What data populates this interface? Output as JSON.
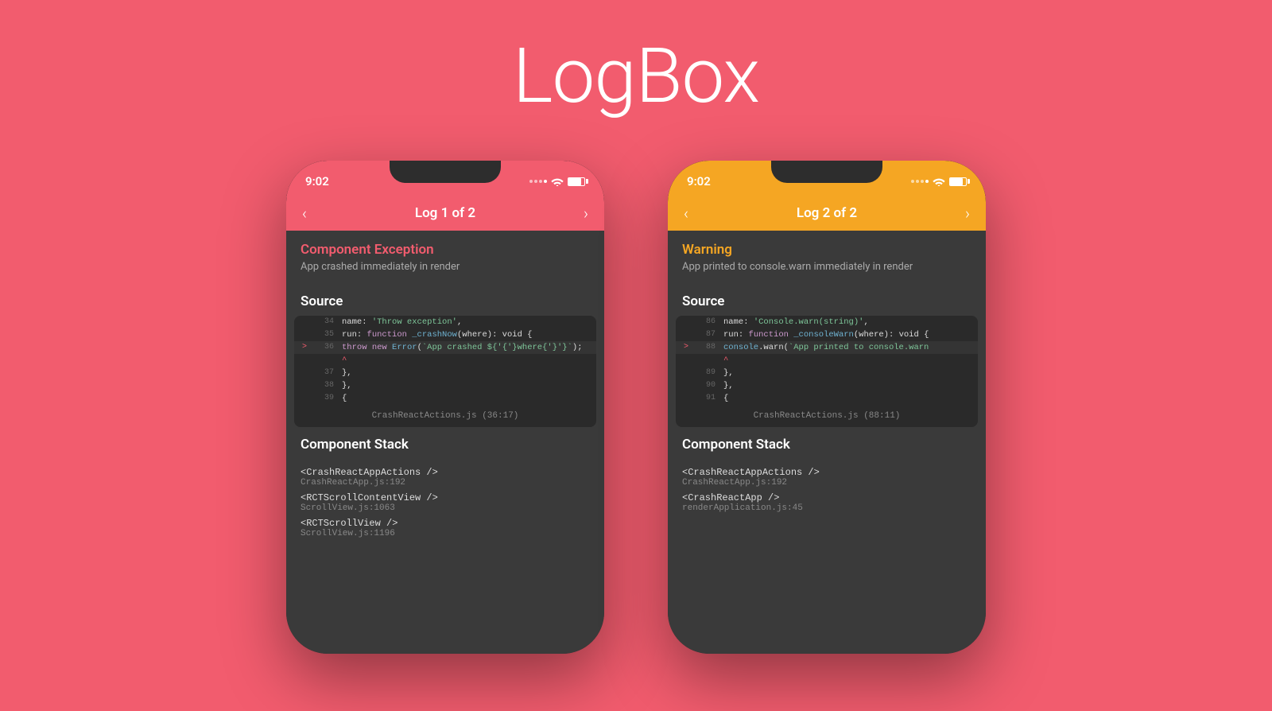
{
  "page": {
    "title": "LogBox",
    "background": "#f25c6e"
  },
  "phone1": {
    "status_time": "9:02",
    "header_title": "Log 1 of 2",
    "header_prev": "‹",
    "header_next": "›",
    "error_title": "Component Exception",
    "error_title_color": "red",
    "error_subtitle": "App crashed immediately in render",
    "source_label": "Source",
    "code_lines": [
      {
        "num": "34",
        "marker": "",
        "text": "name: 'Throw exception',"
      },
      {
        "num": "35",
        "marker": "",
        "text": "run: function _crashNow(where): void {"
      },
      {
        "num": "36",
        "marker": ">",
        "text": "    throw new Error(`App crashed ${where}`);"
      },
      {
        "num": "",
        "marker": "",
        "text": "           ^"
      },
      {
        "num": "37",
        "marker": "",
        "text": "   },"
      },
      {
        "num": "38",
        "marker": "",
        "text": "},"
      },
      {
        "num": "39",
        "marker": "",
        "text": "{"
      }
    ],
    "code_footer": "CrashReactActions.js (36:17)",
    "stack_label": "Component Stack",
    "stack_items": [
      {
        "component": "<CrashReactAppActions />",
        "file": "CrashReactApp.js:192"
      },
      {
        "component": "<RCTScrollContentView />",
        "file": "ScrollView.js:1063"
      },
      {
        "component": "<RCTScrollView />",
        "file": "ScrollView.js:1196"
      }
    ],
    "theme": "error"
  },
  "phone2": {
    "status_time": "9:02",
    "header_title": "Log 2 of 2",
    "header_prev": "‹",
    "header_next": "›",
    "error_title": "Warning",
    "error_title_color": "yellow",
    "error_subtitle": "App printed to console.warn immediately in render",
    "source_label": "Source",
    "code_lines": [
      {
        "num": "86",
        "marker": "",
        "text": "name: 'Console.warn(string)',"
      },
      {
        "num": "87",
        "marker": "",
        "text": "run: function _consoleWarn(where): void {"
      },
      {
        "num": "88",
        "marker": ">",
        "text": "    console.warn(`App printed to console.warn"
      },
      {
        "num": "",
        "marker": "",
        "text": "           ^"
      },
      {
        "num": "89",
        "marker": "",
        "text": "   },"
      },
      {
        "num": "90",
        "marker": "",
        "text": "},"
      },
      {
        "num": "91",
        "marker": "",
        "text": "{"
      }
    ],
    "code_footer": "CrashReactActions.js (88:11)",
    "stack_label": "Component Stack",
    "stack_items": [
      {
        "component": "<CrashReactAppActions />",
        "file": "CrashReactApp.js:192"
      },
      {
        "component": "<CrashReactApp />",
        "file": "renderApplication.js:45"
      }
    ],
    "theme": "warning"
  }
}
